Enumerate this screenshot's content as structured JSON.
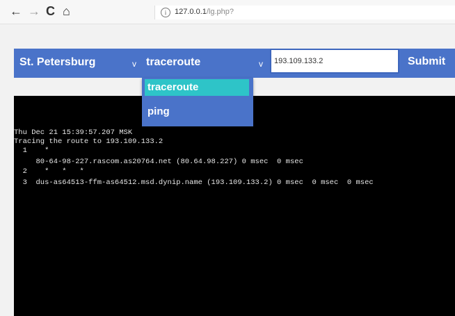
{
  "browser": {
    "nav": {
      "back": "←",
      "forward": "→",
      "reload": "C",
      "home": "⌂"
    },
    "info_glyph": "i",
    "url_host": "127.0.0.1",
    "url_path": "/lg.php?"
  },
  "form": {
    "location_value": "St. Petersburg",
    "tool_value": "traceroute",
    "dropdown_arrow": "v",
    "host_value": "193.109.133.2",
    "submit_label": "Submit",
    "tool_options": [
      "traceroute",
      "ping"
    ],
    "highlighted_option": "traceroute"
  },
  "terminal": {
    "lines": [
      "Thu Dec 21 15:39:57.207 MSK",
      "Tracing the route to 193.109.133.2",
      "  1    *",
      "     80-64-98-227.rascom.as20764.net (80.64.98.227) 0 msec  0 msec",
      "  2    *   *   *",
      "  3  dus-as64513-ffm-as64512.msd.dynip.name (193.109.133.2) 0 msec  0 msec  0 msec"
    ]
  },
  "colors": {
    "form_blue": "#4a73c9",
    "option_highlight": "#2ec4c8",
    "terminal_bg": "#000000",
    "terminal_text": "#e6e6e6"
  }
}
